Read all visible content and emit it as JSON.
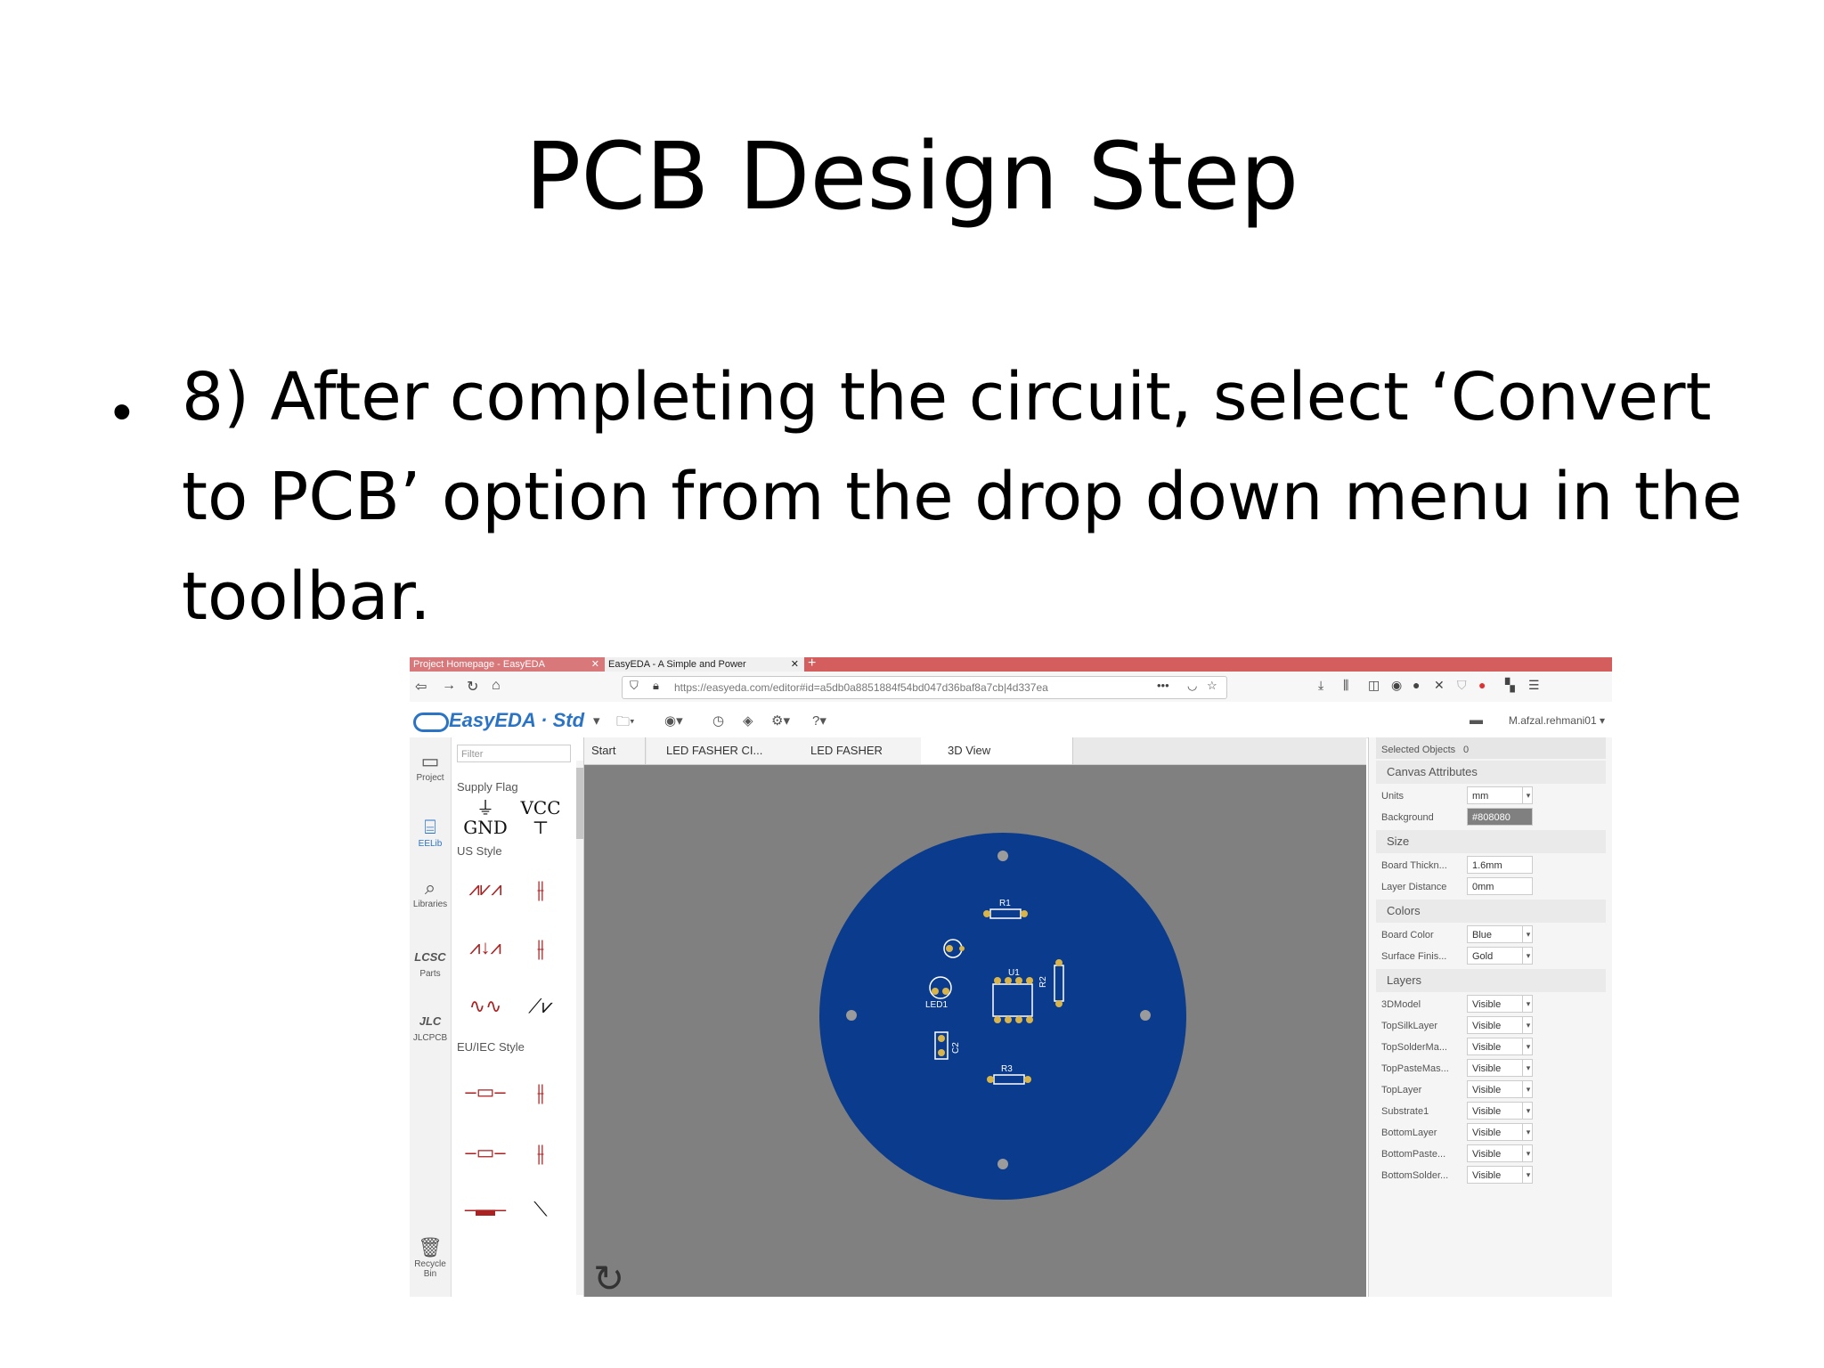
{
  "slide": {
    "title": "PCB Design Step",
    "bullet": "8) After completing the circuit, select ‘Convert to PCB’ option from the drop down menu in the toolbar."
  },
  "browser": {
    "tabs": [
      {
        "label": "Project Homepage - EasyEDA"
      },
      {
        "label": "EasyEDA - A Simple and Power"
      }
    ],
    "url": "https://easyeda.com/editor#id=a5db0a8851884f54bd047d36baf8a7cb|4d337ea"
  },
  "app": {
    "logo": "EasyEDA · Std",
    "user": "M.afzal.rehmani01 ▾"
  },
  "left_nav": [
    {
      "label": "Project",
      "icon": "folder-icon"
    },
    {
      "label": "EELib",
      "icon": "chip-icon"
    },
    {
      "label": "Libraries",
      "icon": "magnifier-icon"
    },
    {
      "label": "Parts",
      "icon": "lcsc-icon"
    },
    {
      "label": "JLCPCB",
      "icon": "jlc-icon"
    },
    {
      "label": "Recycle Bin",
      "icon": "trash-icon"
    }
  ],
  "library_panel": {
    "filter_placeholder": "Filter",
    "sections": [
      "Supply Flag",
      "US Style",
      "EU/IEC Style"
    ],
    "gnd_label": "GND",
    "vcc_label": "VCC"
  },
  "doc_tabs": [
    "Start",
    "LED FASHER CI...",
    "LED FASHER",
    "3D View"
  ],
  "pcb": {
    "board_color": "#0a3b8c",
    "designators": [
      "R1",
      "U1",
      "R2",
      "LED1",
      "C2",
      "R3"
    ]
  },
  "properties": {
    "selected_label": "Selected Objects",
    "selected_count": "0",
    "groups": [
      "Canvas Attributes",
      "Size",
      "Colors",
      "Layers"
    ],
    "canvas_rows": [
      {
        "label": "Units",
        "value": "mm"
      },
      {
        "label": "Background",
        "value": "#808080"
      }
    ],
    "size_rows": [
      {
        "label": "Board Thickn...",
        "value": "1.6mm"
      },
      {
        "label": "Layer Distance",
        "value": "0mm"
      }
    ],
    "color_rows": [
      {
        "label": "Board Color",
        "value": "Blue"
      },
      {
        "label": "Surface Finis...",
        "value": "Gold"
      }
    ],
    "layer_rows": [
      {
        "label": "3DModel",
        "value": "Visible"
      },
      {
        "label": "TopSilkLayer",
        "value": "Visible"
      },
      {
        "label": "TopSolderMa...",
        "value": "Visible"
      },
      {
        "label": "TopPasteMas...",
        "value": "Visible"
      },
      {
        "label": "TopLayer",
        "value": "Visible"
      },
      {
        "label": "Substrate1",
        "value": "Visible"
      },
      {
        "label": "BottomLayer",
        "value": "Visible"
      },
      {
        "label": "BottomPaste...",
        "value": "Visible"
      },
      {
        "label": "BottomSolder...",
        "value": "Visible"
      }
    ]
  }
}
